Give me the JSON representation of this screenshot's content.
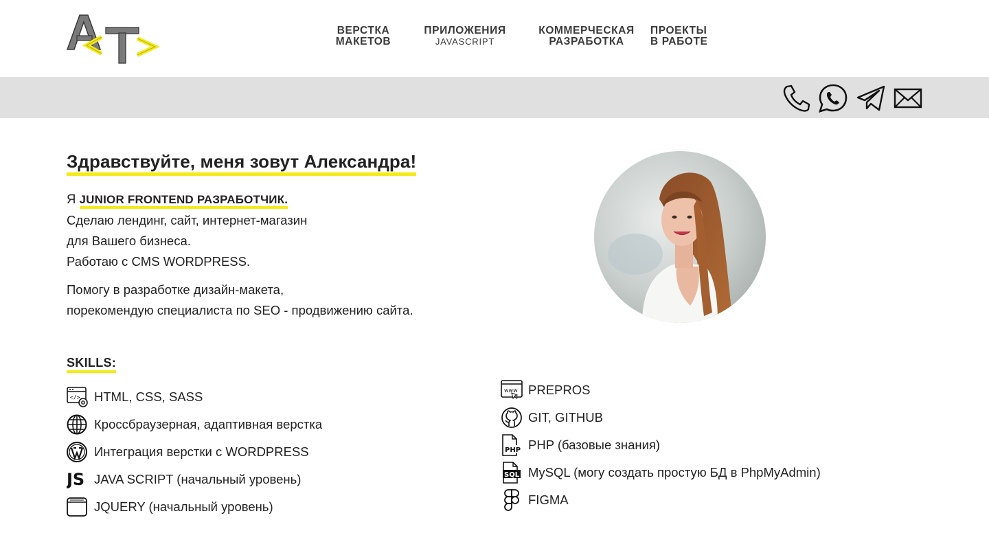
{
  "header": {
    "logo": {
      "letters": [
        "A",
        "T"
      ],
      "brackets": [
        "<",
        ">"
      ],
      "colors": {
        "letters": "#7a7a7a",
        "brackets": "#f4ea17"
      }
    },
    "nav": [
      {
        "line1": "ВЕРСТКА",
        "line2": "МАКЕТОВ"
      },
      {
        "line1": "ПРИЛОЖЕНИЯ",
        "line2": "JAVASCRIPT"
      },
      {
        "line1": "КОММЕРЧЕСКАЯ",
        "line2": "РАЗРАБОТКА"
      },
      {
        "line1": "ПРОЕКТЫ",
        "line2": "В РАБОТЕ"
      }
    ]
  },
  "contacts": {
    "icons": [
      "phone-icon",
      "whatsapp-icon",
      "telegram-icon",
      "mail-icon"
    ]
  },
  "intro": {
    "greeting": "Здравствуйте, меня зовут Александра!",
    "prefix": "Я ",
    "role": "JUNIOR FRONTEND РАЗРАБОТЧИК.",
    "line2": "Сделаю лендинг, сайт, интернет-магазин",
    "line3": "для Вашего бизнеса.",
    "line4": "Работаю с CMS WORDPRESS.",
    "line5": "Помогу в разработке дизайн-макета,",
    "line6": "порекомендую специалиста по SEO - продвижению сайта."
  },
  "skills": {
    "title": "SKILLS:",
    "left": [
      {
        "icon": "code-window-icon",
        "label": "HTML, CSS, SASS"
      },
      {
        "icon": "globe-icon",
        "label": "Кроссбраузерная, адаптивная верстка"
      },
      {
        "icon": "wordpress-icon",
        "label": "Интеграция верстки с WORDPRESS"
      },
      {
        "icon": "js-icon",
        "label": "JAVA SCRIPT (начальный уровень)"
      },
      {
        "icon": "browser-window-icon",
        "label": "JQUERY (начальный уровень)"
      }
    ],
    "right": [
      {
        "icon": "www-window-icon",
        "label": "PREPROS"
      },
      {
        "icon": "github-icon",
        "label": "GIT, GITHUB"
      },
      {
        "icon": "php-file-icon",
        "label": "PHP (базовые знания)"
      },
      {
        "icon": "sql-file-icon",
        "label": "MySQL (могу создать простую БД в PhpMyAdmin)"
      },
      {
        "icon": "figma-icon",
        "label": "FIGMA"
      }
    ]
  },
  "colors": {
    "accent": "#f4ea17",
    "bar": "#e0e0e0",
    "text": "#222222",
    "logoGray": "#7a7a7a"
  }
}
